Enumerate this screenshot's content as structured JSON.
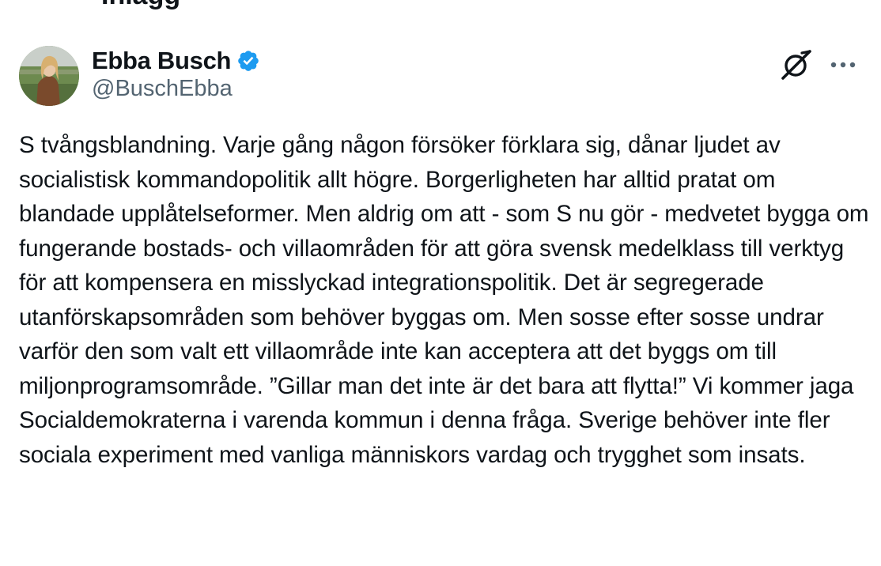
{
  "header_partial": {
    "text": "Inlägg"
  },
  "tweet": {
    "author": {
      "display_name": "Ebba Busch",
      "handle": "@BuschEbba",
      "verified": true,
      "verified_color": "#1d9bf0",
      "avatar_icon": "profile-photo"
    },
    "actions": {
      "grok_icon": "grok-icon",
      "more_icon": "more-options-icon"
    },
    "text": "S tvångsblandning. Varje gång någon försöker förklara sig, dånar ljudet av socialistisk kommandopolitik allt högre. Borgerligheten har alltid pratat om blandade upplåtelseformer. Men aldrig om att - som S nu gör - medvetet bygga om fungerande bostads- och villaområden för att göra svensk medelklass till verktyg för att kompensera en misslyckad integrationspolitik. Det är segregerade utanförskapsområden som behöver byggas om. Men sosse efter sosse undrar varför den som valt ett villaområde inte kan acceptera att det byggs om till miljonprogramsområde. ”Gillar man det inte är det bara att flytta!” Vi kommer jaga Socialdemokraterna i varenda kommun i denna fråga. Sverige behöver inte fler sociala experiment med vanliga människors vardag och trygghet som insats."
  },
  "colors": {
    "text_primary": "#0f1419",
    "text_secondary": "#536471",
    "background": "#ffffff"
  }
}
